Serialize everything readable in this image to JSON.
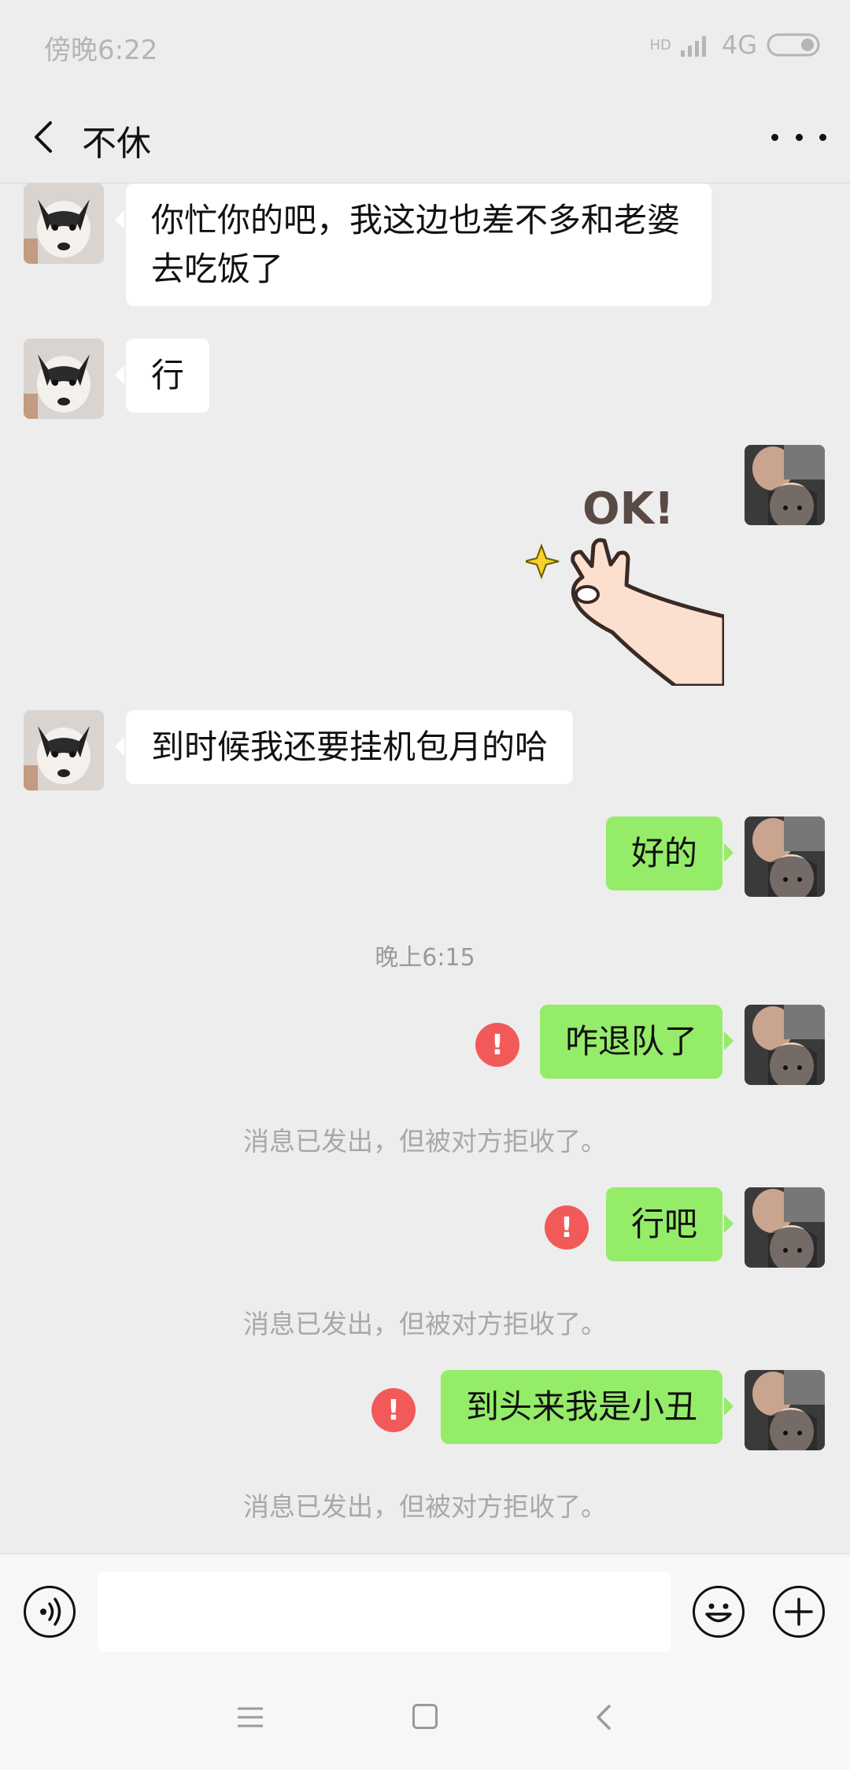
{
  "status": {
    "time": "傍晚6:22",
    "network": "4G",
    "hd": "HD"
  },
  "header": {
    "title": "不休"
  },
  "messages": [
    {
      "dir": "in",
      "text": "你忙你的吧，我这边也差不多和老婆去吃饭了"
    },
    {
      "dir": "in",
      "text": "行"
    },
    {
      "dir": "out",
      "type": "sticker",
      "sticker_text": "OK!"
    },
    {
      "dir": "in",
      "text": "到时候我还要挂机包月的哈"
    },
    {
      "dir": "out",
      "text": "好的"
    },
    {
      "dir": "time",
      "text": "晚上6:15"
    },
    {
      "dir": "out",
      "text": "咋退队了",
      "status": "failed",
      "note": "消息已发出，但被对方拒收了。"
    },
    {
      "dir": "out",
      "text": "行吧",
      "status": "failed",
      "note": "消息已发出，但被对方拒收了。"
    },
    {
      "dir": "out",
      "text": "到头来我是小丑",
      "status": "failed",
      "note": "消息已发出，但被对方拒收了。"
    }
  ],
  "input": {
    "placeholder": ""
  },
  "icons": {
    "back": "chevron-left-icon",
    "more": "more-icon",
    "voice": "voice-icon",
    "emoji": "emoji-icon",
    "plus": "plus-icon",
    "error": "error-icon"
  },
  "colors": {
    "outgoing_bubble": "#95ec69",
    "incoming_bubble": "#ffffff",
    "error": "#f25a5a",
    "background": "#ededed"
  }
}
